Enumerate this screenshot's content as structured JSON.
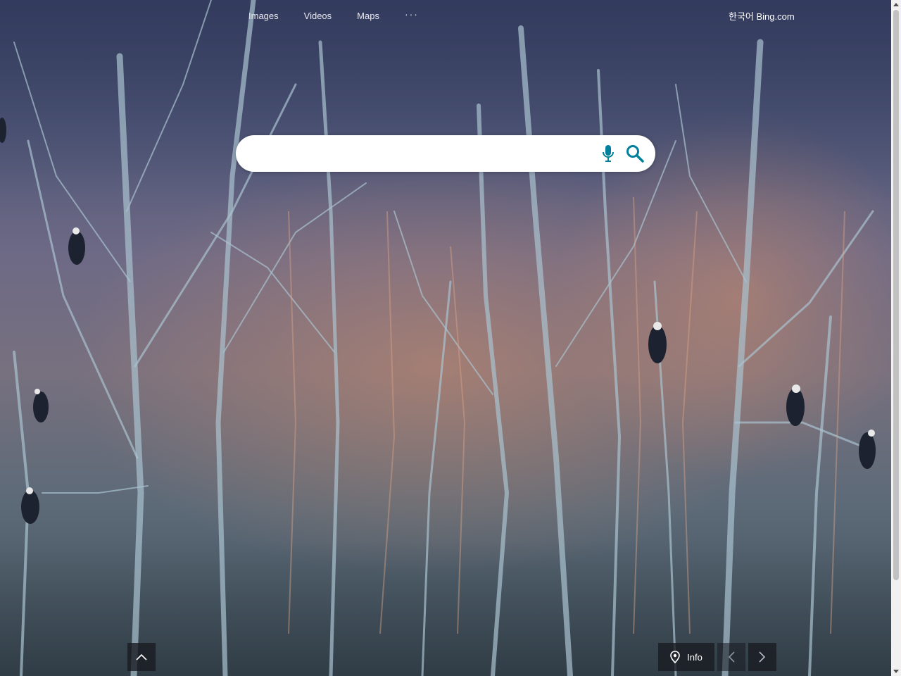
{
  "nav": {
    "images": "Images",
    "videos": "Videos",
    "maps": "Maps",
    "more": "···"
  },
  "lang_link": "한국어 Bing.com",
  "search": {
    "value": "",
    "placeholder": ""
  },
  "bottom": {
    "info_label": "Info"
  },
  "icons": {
    "mic": "microphone-icon",
    "search": "magnifier-icon",
    "scroll_up": "chevron-up-icon",
    "location": "location-pin-icon",
    "prev": "chevron-left-icon",
    "next": "chevron-right-icon"
  },
  "colors": {
    "search_accent": "#00809d",
    "sky_top": "#3a4266",
    "glow": "#c98a6a"
  }
}
